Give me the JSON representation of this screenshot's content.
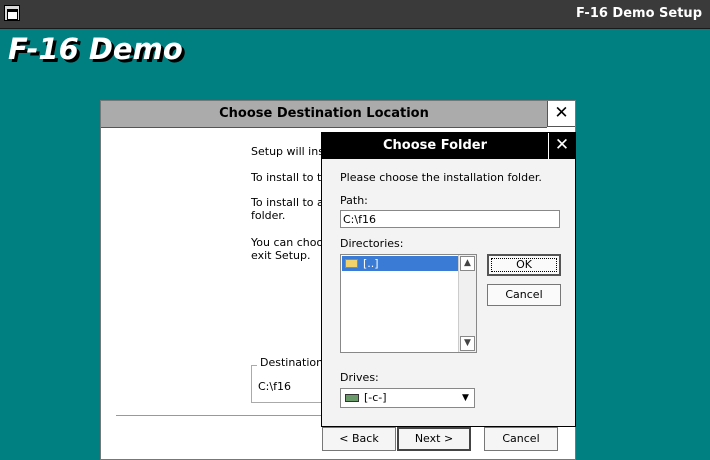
{
  "window": {
    "title": "F-16 Demo Setup"
  },
  "app_title": "F-16 Demo",
  "dest_dialog": {
    "title": "Choose Destination Location",
    "lines": [
      "Setup will insta",
      "To install to thi",
      "To install to a d",
      "folder.",
      "You can choos",
      "exit Setup."
    ],
    "group_label": "Destination F",
    "group_path": "C:\\f16",
    "close_glyph": "✕"
  },
  "folder_dialog": {
    "title": "Choose Folder",
    "close_glyph": "✕",
    "instruction": "Please choose the installation folder.",
    "path_label": "Path:",
    "path_value": "C:\\f16",
    "directories_label": "Directories:",
    "directories": [
      "[..]"
    ],
    "ok_label": "OK",
    "cancel_label": "Cancel",
    "drives_label": "Drives:",
    "drive_value": "[-c-]"
  },
  "nav": {
    "back_label": "< Back",
    "next_label": "Next >",
    "cancel_label": "Cancel"
  },
  "icons": {
    "system_menu": "system-menu-icon",
    "folder": "folder-icon",
    "drive": "hard-drive-icon",
    "scroll_up": "▲",
    "scroll_down": "▼",
    "dropdown": "▼"
  }
}
